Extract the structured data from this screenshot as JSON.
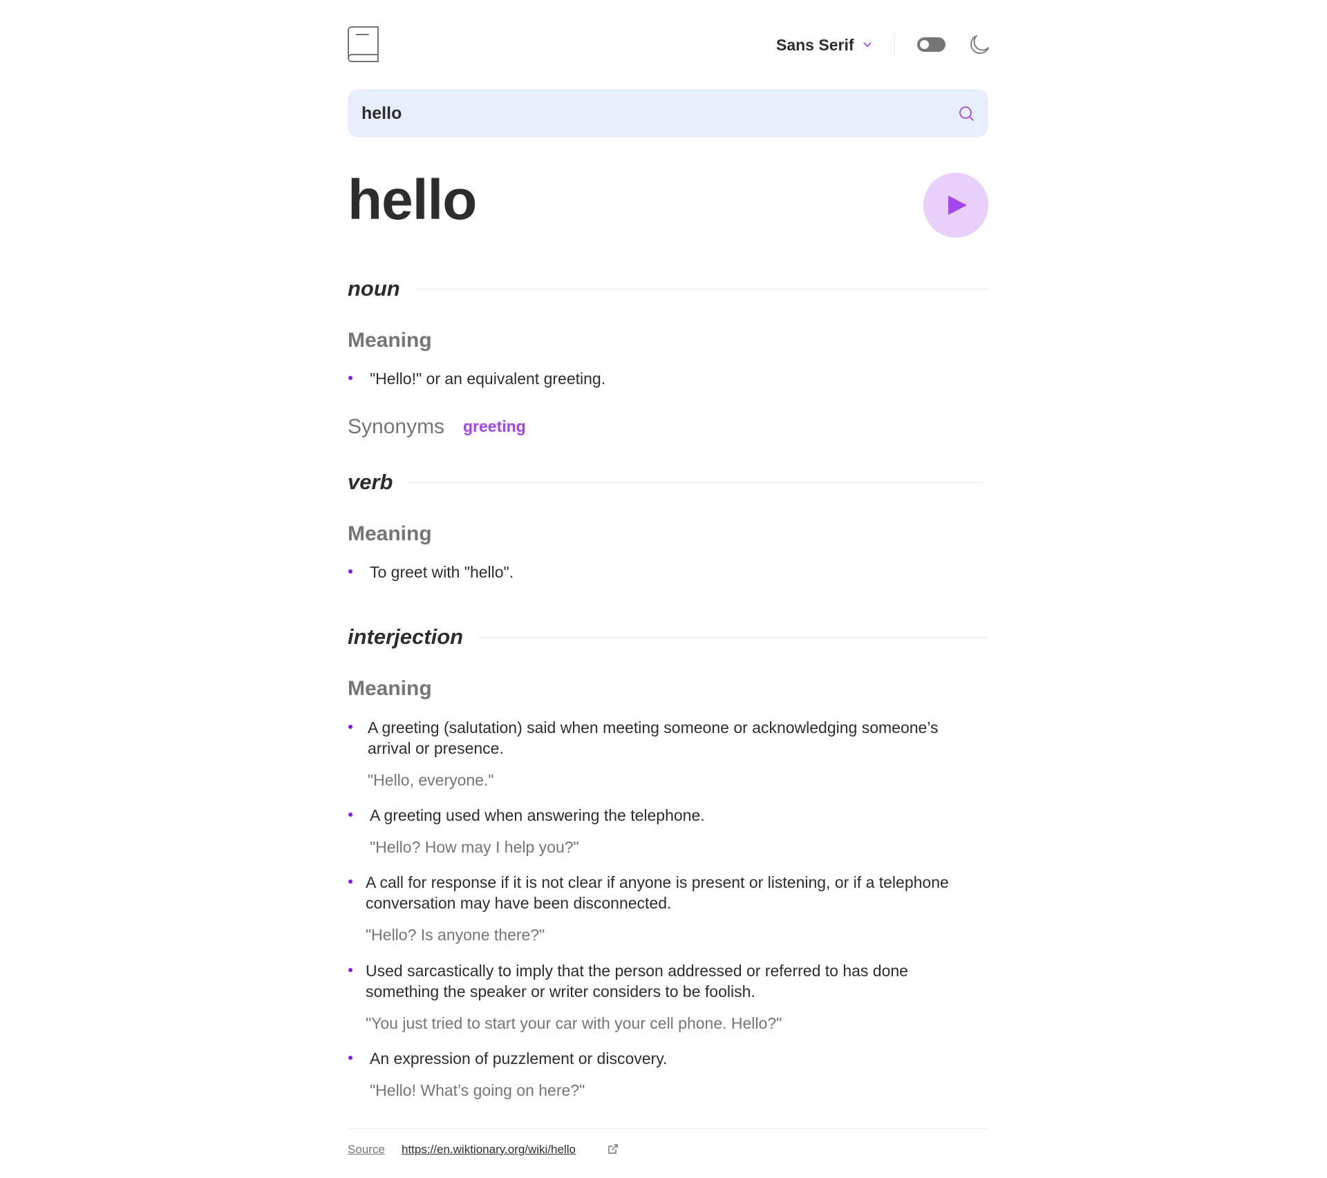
{
  "header": {
    "logo_icon": "book-icon",
    "font_label": "Sans Serif",
    "theme_toggle_icon": "toggle-icon",
    "theme_icon": "moon-icon"
  },
  "search": {
    "value": "hello",
    "icon": "search-icon"
  },
  "word": {
    "title": "hello",
    "play_icon": "play-icon"
  },
  "meanings": [
    {
      "part_of_speech": "noun",
      "heading": "Meaning",
      "definitions": [
        {
          "text": "\"Hello!\" or an equivalent greeting."
        }
      ],
      "synonyms_label": "Synonyms",
      "synonyms": [
        "greeting"
      ]
    },
    {
      "part_of_speech": "verb",
      "heading": "Meaning",
      "definitions": [
        {
          "text": "To greet with \"hello\"."
        }
      ]
    },
    {
      "part_of_speech": "interjection",
      "heading": "Meaning",
      "definitions": [
        {
          "text": "A greeting (salutation) said when meeting someone or acknowledging someone’s arrival or presence.",
          "example": "\"Hello, everyone.\""
        },
        {
          "text": "A greeting used when answering the telephone.",
          "example": "\"Hello? How may I help you?\""
        },
        {
          "text": "A call for response if it is not clear if anyone is present or listening, or if a telephone conversation may have been disconnected.",
          "example": "\"Hello? Is anyone there?\""
        },
        {
          "text": "Used sarcastically to imply that the person addressed or referred to has done something the speaker or writer considers to be foolish.",
          "example": "\"You just tried to start your car with your cell phone. Hello?\""
        },
        {
          "text": "An expression of puzzlement or discovery.",
          "example": "\"Hello! What’s going on here?\""
        }
      ]
    }
  ],
  "footer": {
    "source_label": "Source",
    "source_url": "https://en.wiktionary.org/wiki/hello",
    "external_icon": "external-link-icon"
  },
  "colors": {
    "accent": "#a445ed",
    "text": "#2d2d2d",
    "muted": "#757575",
    "search_bg": "#e8effc",
    "play_bg": "#e9d0fa"
  }
}
